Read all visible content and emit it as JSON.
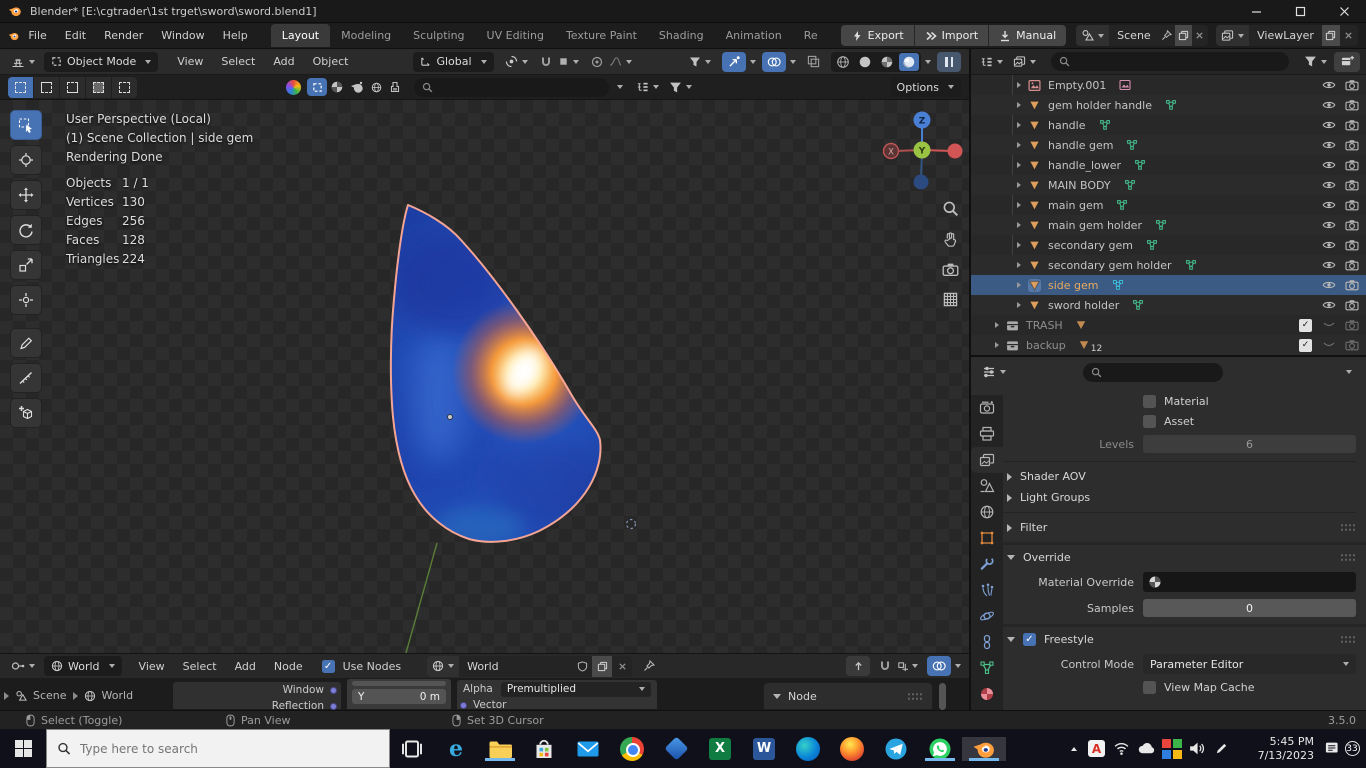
{
  "colors": {
    "accent": "#4772b3",
    "selection_row": "#3b5b85",
    "mesh_icon": "#dd9f5f",
    "mesh_data_icon": "#45c08f",
    "active_text": "#eaa85c",
    "gem_blue": "#2b5fd0",
    "gem_glow": "#ff9c33",
    "axis_x": "#e24f4f",
    "axis_y": "#9ac243",
    "axis_z": "#4a7fd6",
    "running_underline": "#76b9ed"
  },
  "window": {
    "title": "Blender* [E:\\cgtrader\\1st trget\\sword\\sword.blend1]"
  },
  "topbar": {
    "menus": [
      "File",
      "Edit",
      "Render",
      "Window",
      "Help"
    ],
    "workspaces": [
      "Layout",
      "Modeling",
      "Sculpting",
      "UV Editing",
      "Texture Paint",
      "Shading",
      "Animation",
      "Re"
    ],
    "active_workspace": "Layout",
    "export_label": "Export",
    "import_label": "Import",
    "manual_label": "Manual",
    "scene_value": "Scene",
    "view_layer_value": "ViewLayer"
  },
  "viewport": {
    "header": {
      "mode": "Object Mode",
      "menus": [
        "View",
        "Select",
        "Add",
        "Object"
      ],
      "orientation": "Global",
      "options_label": "Options"
    },
    "overlay": {
      "view_label": "User Perspective (Local)",
      "context_label": "(1) Scene Collection | side gem",
      "render_status": "Rendering Done",
      "stats": [
        {
          "label": "Objects",
          "value": "1 / 1"
        },
        {
          "label": "Vertices",
          "value": "130"
        },
        {
          "label": "Edges",
          "value": "256"
        },
        {
          "label": "Faces",
          "value": "128"
        },
        {
          "label": "Triangles",
          "value": "224"
        }
      ]
    },
    "gizmo": {
      "x": "X",
      "y": "Y",
      "z": "Z"
    },
    "tools": [
      "tweak-select",
      "cursor",
      "move",
      "rotate",
      "scale",
      "transform",
      "annotate",
      "measure",
      "add-cube"
    ],
    "active_tool": "tweak-select"
  },
  "outliner": {
    "items": [
      {
        "name": "Empty.001",
        "type": "empty"
      },
      {
        "name": "gem holder handle",
        "type": "mesh"
      },
      {
        "name": "handle",
        "type": "mesh"
      },
      {
        "name": "handle gem",
        "type": "mesh"
      },
      {
        "name": "handle_lower",
        "type": "mesh"
      },
      {
        "name": "MAIN BODY",
        "type": "mesh"
      },
      {
        "name": "main gem",
        "type": "mesh"
      },
      {
        "name": "main gem holder",
        "type": "mesh"
      },
      {
        "name": "secondary gem",
        "type": "mesh"
      },
      {
        "name": "secondary gem holder",
        "type": "mesh"
      },
      {
        "name": "side gem",
        "type": "mesh",
        "selected": true
      },
      {
        "name": "sword holder",
        "type": "mesh"
      }
    ],
    "collections": [
      {
        "name": "TRASH",
        "count": ""
      },
      {
        "name": "backup",
        "count": "12"
      }
    ]
  },
  "properties": {
    "active_tab": "view-layer",
    "tabs": [
      "render",
      "output",
      "view-layer",
      "scene",
      "world",
      "object",
      "modifiers",
      "particles",
      "physics",
      "constraints",
      "object-data",
      "material"
    ],
    "material_label": "Material",
    "asset_label": "Asset",
    "levels_label": "Levels",
    "levels_value": "6",
    "shader_aov_label": "Shader AOV",
    "light_groups_label": "Light Groups",
    "filter_label": "Filter",
    "override_label": "Override",
    "material_override_label": "Material Override",
    "samples_label": "Samples",
    "samples_value": "0",
    "freestyle_label": "Freestyle",
    "control_mode_label": "Control Mode",
    "control_mode_value": "Parameter Editor",
    "view_map_cache_label": "View Map Cache"
  },
  "shader_editor": {
    "type_value": "World",
    "menus": [
      "View",
      "Select",
      "Add",
      "Node"
    ],
    "use_nodes_label": "Use Nodes",
    "datablock_value": "World",
    "node_panel_label": "Node",
    "breadcrumb": {
      "scene": "Scene",
      "world": "World"
    },
    "nodes": {
      "window_label": "Window",
      "reflection_label": "Reflection",
      "y_label": "Y",
      "y_value": "0 m",
      "alpha_label": "Alpha",
      "alpha_value": "Premultiplied",
      "vector_label": "Vector"
    }
  },
  "status_bar": {
    "select_hint": "Select (Toggle)",
    "pan_hint": "Pan View",
    "cursor_hint": "Set 3D Cursor",
    "version": "3.5.0"
  },
  "taskbar": {
    "search_placeholder": "Type here to search",
    "time": "5:45 PM",
    "date": "7/13/2023",
    "notification_count": "33",
    "glyphs": {
      "edge_legacy": "e",
      "excel": "X",
      "word": "W",
      "acrobat": "A"
    },
    "apps": [
      {
        "name": "task-view"
      },
      {
        "name": "edge-legacy"
      },
      {
        "name": "file-explorer",
        "running": true
      },
      {
        "name": "store"
      },
      {
        "name": "mail"
      },
      {
        "name": "chrome"
      },
      {
        "name": "blue-box"
      },
      {
        "name": "excel"
      },
      {
        "name": "word"
      },
      {
        "name": "edge"
      },
      {
        "name": "firefox"
      },
      {
        "name": "telegram"
      },
      {
        "name": "whatsapp",
        "running": true
      },
      {
        "name": "blender",
        "running": true,
        "active": true
      }
    ],
    "tray": [
      "tray-expand",
      "acrobat",
      "wifi",
      "onedrive",
      "office",
      "volume",
      "pen"
    ]
  }
}
